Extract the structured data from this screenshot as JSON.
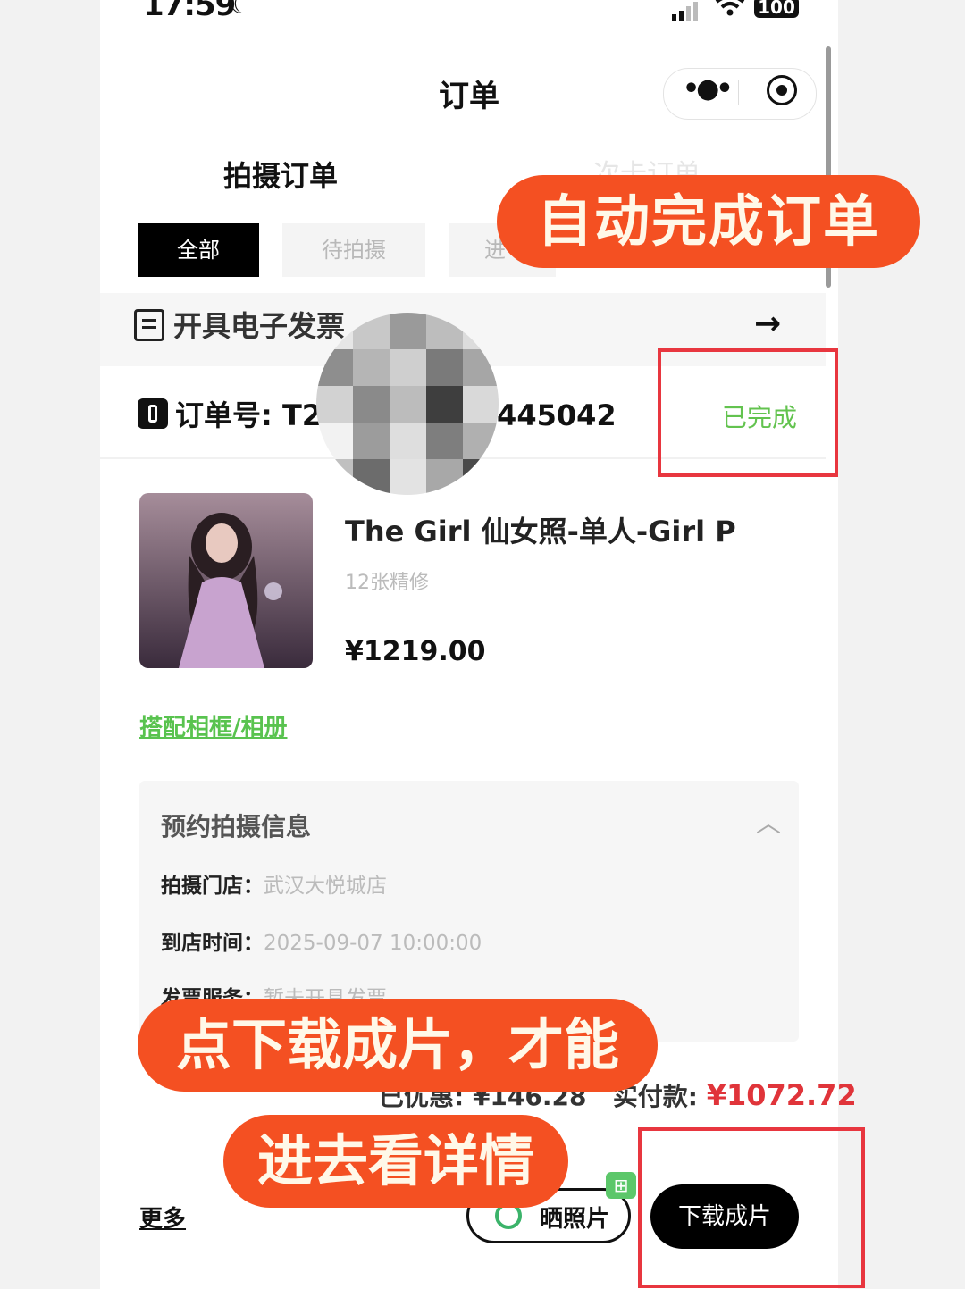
{
  "status_bar": {
    "time": "17:59",
    "battery": "100"
  },
  "nav": {
    "title": "订单"
  },
  "tabs": {
    "shoot": "拍摄订单",
    "other": "次卡订单"
  },
  "filters": {
    "all": "全部",
    "waiting": "待拍摄",
    "in_progress": "进"
  },
  "invoice": {
    "label": "开具电子发票",
    "arrow": "→"
  },
  "order": {
    "number_left": "订单号: T2",
    "number_right": "445042",
    "status": "已完成",
    "product_title": "The Girl 仙女照-单人-Girl P",
    "product_sub": "12张精修",
    "price": "¥1219.00",
    "frame_link": "搭配相框/相册"
  },
  "booking": {
    "title": "预约拍摄信息",
    "chevron": "︿",
    "store_label": "拍摄门店：",
    "store_value": "武汉大悦城店",
    "time_label": "到店时间：",
    "time_value": "2025-09-07 10:00:00",
    "invoice_label": "发票服务：",
    "invoice_value": "暂未开具发票"
  },
  "totals": {
    "discount_label": "已优惠:",
    "discount_value": "¥146.28",
    "paid_label": "实付款:",
    "paid_value": "¥1072.72"
  },
  "bottom": {
    "more": "更多",
    "share": "晒照片",
    "download": "下载成片"
  },
  "overlays": {
    "top_caption": "自动完成订单",
    "bottom_caption_1": "点下载成片，才能",
    "bottom_caption_2": "进去看详情"
  },
  "colors": {
    "accent_green": "#63c34f",
    "price_red": "#e0343a",
    "caption_orange": "#f45022",
    "highlight_red": "#e8363f"
  }
}
